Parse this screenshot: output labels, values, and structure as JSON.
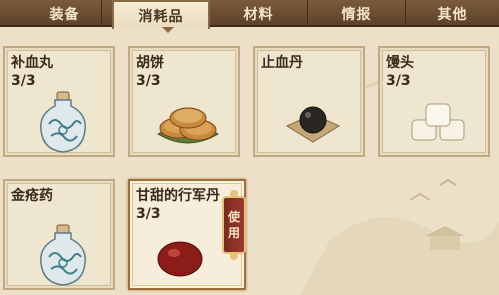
{
  "tabs": [
    {
      "label": "装备",
      "active": false
    },
    {
      "label": "消耗品",
      "active": true
    },
    {
      "label": "材料",
      "active": false
    },
    {
      "label": "情报",
      "active": false
    },
    {
      "label": "其他",
      "active": false
    }
  ],
  "items": [
    {
      "name": "补血丸",
      "count": "3/3",
      "icon": "medicine-bottle-icon"
    },
    {
      "name": "胡饼",
      "count": "3/3",
      "icon": "flatbread-icon"
    },
    {
      "name": "止血丹",
      "count": "",
      "icon": "black-pill-icon"
    },
    {
      "name": "馒头",
      "count": "3/3",
      "icon": "steamed-bun-icon"
    },
    {
      "name": "金疮药",
      "count": "",
      "icon": "medicine-bottle-icon"
    },
    {
      "name": "甘甜的行军丹",
      "count": "3/3",
      "icon": "red-pill-icon",
      "selected": true
    }
  ],
  "use_button": {
    "chars": [
      "使",
      "用"
    ]
  },
  "colors": {
    "tabbar": "#6b4c30",
    "card_bg": "#efe6cf",
    "card_border": "#c3a983",
    "use_button": "#8a3228",
    "text": "#3a2a1a"
  }
}
